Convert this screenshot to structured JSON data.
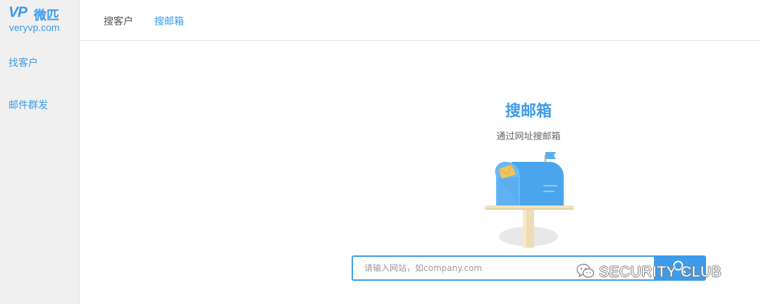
{
  "logo": {
    "mark": "VP",
    "name": "微匹",
    "domain": "veryvp.com"
  },
  "sidebar": {
    "items": [
      {
        "label": "找客户"
      },
      {
        "label": "邮件群发"
      }
    ]
  },
  "tabs": [
    {
      "label": "搜客户",
      "active": false
    },
    {
      "label": "搜邮箱",
      "active": true
    }
  ],
  "main": {
    "title": "搜邮箱",
    "subtitle": "通过网址搜邮箱",
    "search": {
      "placeholder": "请输入网站，如company.com",
      "value": ""
    }
  },
  "watermark": {
    "text": "SECURITY CLUB"
  },
  "colors": {
    "accent": "#3d9bea",
    "sidebar_bg": "#f0f0f0"
  },
  "icons": {
    "illustration": "mailbox-icon",
    "search": "search-icon",
    "watermark": "wechat-icon"
  }
}
